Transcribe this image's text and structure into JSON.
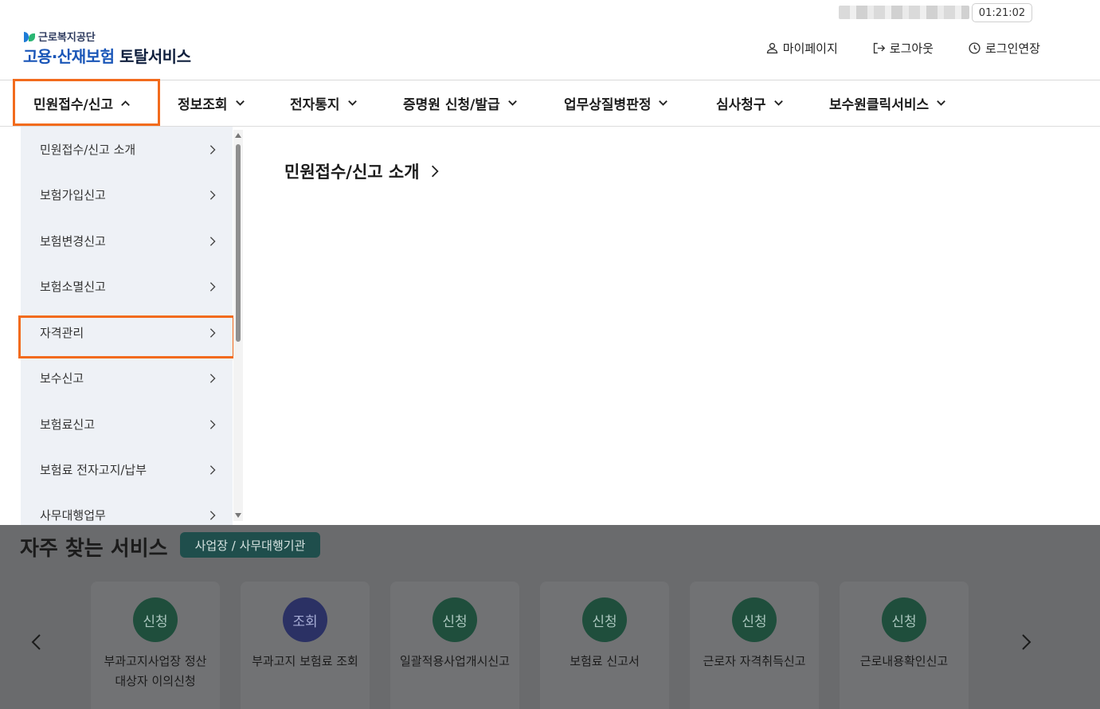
{
  "header": {
    "timer": "01:21:02",
    "org_name": "근로복지공단",
    "title_highlight": "고용·산재보험",
    "title_rest": "토탈서비스",
    "utils": [
      {
        "label": "마이페이지",
        "icon": "person-icon"
      },
      {
        "label": "로그아웃",
        "icon": "logout-icon"
      },
      {
        "label": "로그인연장",
        "icon": "clock-icon"
      }
    ]
  },
  "nav": {
    "items": [
      {
        "label": "민원접수/신고",
        "state": "expanded"
      },
      {
        "label": "정보조회"
      },
      {
        "label": "전자통지"
      },
      {
        "label": "증명원 신청/발급"
      },
      {
        "label": "업무상질병판정"
      },
      {
        "label": "심사청구"
      },
      {
        "label": "보수원클릭서비스"
      }
    ]
  },
  "submenu": {
    "items": [
      {
        "label": "민원접수/신고 소개"
      },
      {
        "label": "보험가입신고"
      },
      {
        "label": "보험변경신고"
      },
      {
        "label": "보험소멸신고"
      },
      {
        "label": "자격관리",
        "highlighted": true
      },
      {
        "label": "보수신고"
      },
      {
        "label": "보험료신고"
      },
      {
        "label": "보험료 전자고지/납부"
      },
      {
        "label": "사무대행업무"
      }
    ]
  },
  "content": {
    "title": "민원접수/신고 소개"
  },
  "services": {
    "title": "자주 찾는 서비스",
    "tag": "사업장 / 사무대행기관",
    "cards": [
      {
        "badge": "신청",
        "label": "부과고지사업장 정산 대상자 이의신청"
      },
      {
        "badge": "조회",
        "label": "부과고지 보험료 조회"
      },
      {
        "badge": "신청",
        "label": "일괄적용사업개시신고"
      },
      {
        "badge": "신청",
        "label": "보험료 신고서"
      },
      {
        "badge": "신청",
        "label": "근로자 자격취득신고"
      },
      {
        "badge": "신청",
        "label": "근로내용확인신고"
      }
    ]
  },
  "colors": {
    "highlight_border": "#f26b1d",
    "brand_blue": "#1a56b8",
    "submenu_bg": "#eef1f6",
    "apply_badge": "#1f4e3c",
    "query_badge": "#2b3164",
    "overlay": "#6a6b6d"
  }
}
